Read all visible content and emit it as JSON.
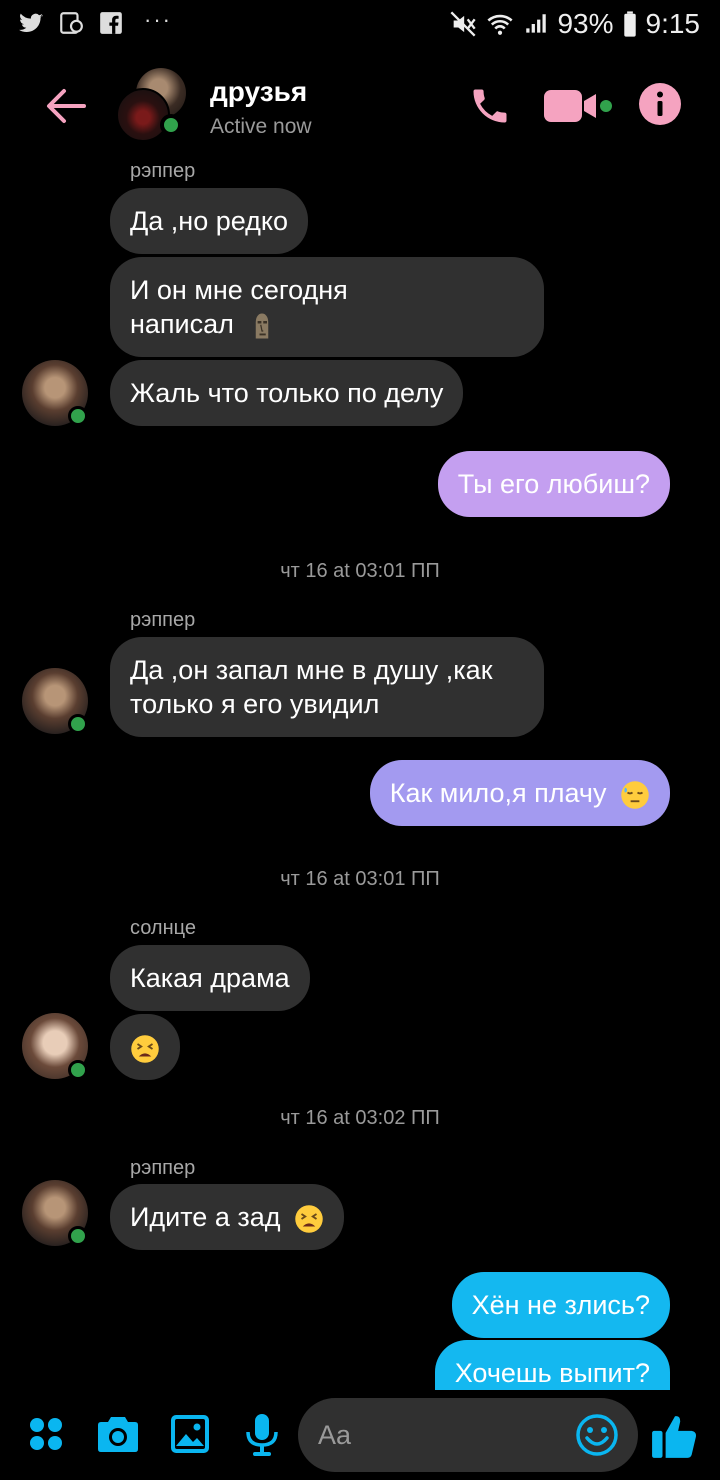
{
  "status_bar": {
    "battery": "93%",
    "time": "9:15",
    "left_icons": [
      "twitter-icon",
      "notification-icon",
      "facebook-icon"
    ],
    "more": "···"
  },
  "header": {
    "title": "друзья",
    "status": "Active now",
    "accent_color": "#f5a3c0"
  },
  "messages": [
    {
      "type": "sender",
      "text": "рэппер"
    },
    {
      "type": "in",
      "text": "Да ,но редко"
    },
    {
      "type": "in",
      "lines": [
        "И он мне сегодня",
        "написал"
      ],
      "emoji": "moai-emoji-icon"
    },
    {
      "type": "in",
      "text": "Жаль что только по делу"
    },
    {
      "type": "out",
      "text": "Ты его любиш?",
      "color": "#c49ff0"
    },
    {
      "type": "timestamp",
      "text": "чт 16 at 03:01 ПП"
    },
    {
      "type": "sender",
      "text": "рэппер"
    },
    {
      "type": "in",
      "lines": [
        "Да ,он запал мне в душу ,как",
        "только я его увидил"
      ]
    },
    {
      "type": "out",
      "text": "Как мило,я плачу",
      "emoji": "downcast-sweat-emoji-icon",
      "color": "#a39af0"
    },
    {
      "type": "timestamp",
      "text": "чт 16 at 03:01 ПП"
    },
    {
      "type": "sender",
      "text": "солнце"
    },
    {
      "type": "in",
      "text": "Какая драма"
    },
    {
      "type": "in",
      "emoji_only": "tired-face-emoji-icon"
    },
    {
      "type": "timestamp",
      "text": "чт 16 at 03:02 ПП"
    },
    {
      "type": "sender",
      "text": "рэппер"
    },
    {
      "type": "in",
      "text": "Идите а зад",
      "emoji": "tired-face-emoji-icon"
    },
    {
      "type": "out",
      "text": "Хён не злись?",
      "color": "#14b8f0"
    },
    {
      "type": "out",
      "text": "Хочешь выпит?",
      "color": "#14b8f0"
    }
  ],
  "composer": {
    "placeholder": "Aa",
    "icons": [
      "apps-icon",
      "camera-icon",
      "gallery-icon",
      "microphone-icon",
      "emoji-icon",
      "thumbs-up-icon"
    ],
    "accent_color": "#0ab6f0"
  }
}
